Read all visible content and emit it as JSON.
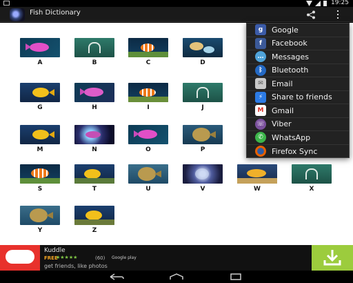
{
  "status": {
    "time": "19:25"
  },
  "app": {
    "title": "Fish Dictionary"
  },
  "tiles": [
    {
      "letter": "A"
    },
    {
      "letter": "B"
    },
    {
      "letter": "C"
    },
    {
      "letter": "D"
    },
    {
      "letter": "G"
    },
    {
      "letter": "H"
    },
    {
      "letter": "I"
    },
    {
      "letter": "J"
    },
    {
      "letter": "M"
    },
    {
      "letter": "N"
    },
    {
      "letter": "O"
    },
    {
      "letter": "P"
    },
    {
      "letter": "S"
    },
    {
      "letter": "T"
    },
    {
      "letter": "U"
    },
    {
      "letter": "V"
    },
    {
      "letter": "W"
    },
    {
      "letter": "X"
    },
    {
      "letter": "Y"
    },
    {
      "letter": "Z"
    }
  ],
  "share_menu": {
    "items": [
      {
        "label": "Google",
        "icon": "google-icon",
        "color": "#3b5ba8"
      },
      {
        "label": "Facebook",
        "icon": "facebook-icon",
        "color": "#3b5998"
      },
      {
        "label": "Messages",
        "icon": "messages-icon",
        "color": "#4fa3d9"
      },
      {
        "label": "Bluetooth",
        "icon": "bluetooth-icon",
        "color": "#2469c4"
      },
      {
        "label": "Email",
        "icon": "email-icon",
        "color": "#c9c9c9"
      },
      {
        "label": "Share to friends",
        "icon": "share-friends-icon",
        "color": "#2c7be5"
      },
      {
        "label": "Gmail",
        "icon": "gmail-icon",
        "color": "#d93025"
      },
      {
        "label": "Viber",
        "icon": "viber-icon",
        "color": "#7b519d"
      },
      {
        "label": "WhatsApp",
        "icon": "whatsapp-icon",
        "color": "#3cb54a"
      },
      {
        "label": "Firefox Sync",
        "icon": "firefox-icon",
        "color": "#e66000"
      }
    ]
  },
  "ad": {
    "title": "Kuddle",
    "free": "FREE",
    "stars": "★★★★★",
    "rating_count": "(60)",
    "store": "Google play",
    "subtitle": "get friends, like photos"
  }
}
